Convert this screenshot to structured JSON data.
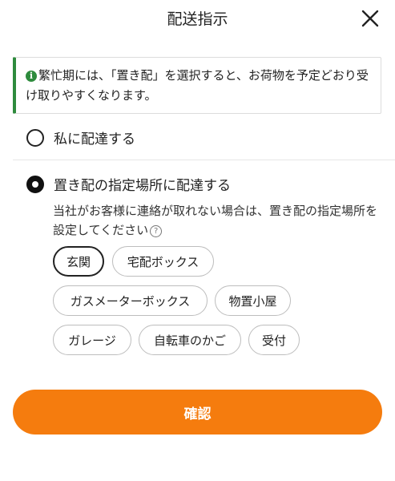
{
  "header": {
    "title": "配送指示"
  },
  "notice": {
    "icon": "info-icon",
    "text": "繁忙期には、「置き配」を選択すると、お荷物を予定どおり受け取りやすくなります。",
    "accent_color": "#2e8b3d"
  },
  "options": [
    {
      "label": "私に配達する",
      "selected": false
    },
    {
      "label": "置き配の指定場所に配達する",
      "selected": true
    }
  ],
  "placement": {
    "description": "当社がお客様に連絡が取れない場合は、置き配の指定場所を設定してください",
    "help_icon": "help-circle-icon",
    "chips": [
      "玄関",
      "宅配ボックス",
      "ガスメーターボックス",
      "物置小屋",
      "ガレージ",
      "自転車のかご",
      "受付"
    ],
    "selected_chip": "玄関"
  },
  "confirm": {
    "label": "確認",
    "color": "#f57c0e"
  }
}
